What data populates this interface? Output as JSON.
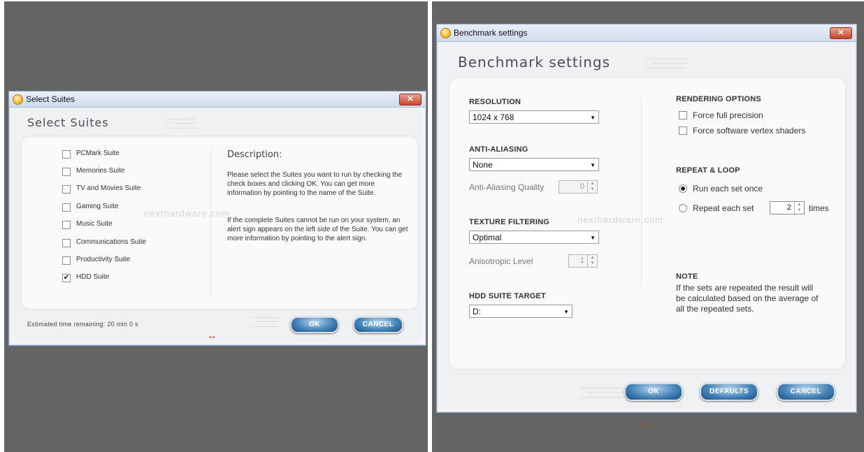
{
  "left_window": {
    "title": "Select Suites",
    "header": "Select Suites",
    "close_label": "✕",
    "suites": [
      {
        "label": "PCMark Suite",
        "checked": false
      },
      {
        "label": "Memories Suite",
        "checked": false
      },
      {
        "label": "TV and Movies Suite",
        "checked": false
      },
      {
        "label": "Gaming Suite",
        "checked": false
      },
      {
        "label": "Music Suite",
        "checked": false
      },
      {
        "label": "Communications Suite",
        "checked": false
      },
      {
        "label": "Productivity Suite",
        "checked": false
      },
      {
        "label": "HDD Suite",
        "checked": true
      }
    ],
    "description_heading": "Description:",
    "description_p1": "Please select the Suites you want to run by checking the check boxes and clicking OK. You can get more information by pointing to the name of the Suite.",
    "description_p2": "If the complete Suites cannot be run on your system, an alert sign appears on the left side of the Suite. You can get more information by pointing to the alert sign.",
    "estimated_time": "Estimated time remaining: 20 min 0 s",
    "ok_label": "OK",
    "cancel_label": "CANCEL"
  },
  "right_window": {
    "title": "Benchmark settings",
    "header": "Benchmark settings",
    "close_label": "✕",
    "resolution": {
      "heading": "RESOLUTION",
      "value": "1024 x 768"
    },
    "anti_aliasing": {
      "heading": "ANTI-ALIASING",
      "value": "None",
      "quality_label": "Anti-Aliasing Quality",
      "quality_value": "0"
    },
    "texture_filtering": {
      "heading": "TEXTURE FILTERING",
      "value": "Optimal",
      "aniso_label": "Anisotropic Level",
      "aniso_value": "1"
    },
    "hdd_target": {
      "heading": "HDD SUITE TARGET",
      "value": "D:"
    },
    "rendering_options": {
      "heading": "RENDERING OPTIONS",
      "force_full_precision": "Force full precision",
      "force_software_vertex": "Force software vertex shaders"
    },
    "repeat_loop": {
      "heading": "REPEAT & LOOP",
      "run_once": "Run each set once",
      "repeat_each": "Repeat each set",
      "repeat_count": "2",
      "times": "times",
      "selected": "run_once"
    },
    "note": {
      "heading": "NOTE",
      "text": "If the sets are repeated the result will be calculated based on the average of all the repeated sets."
    },
    "ok_label": "OK",
    "defaults_label": "DEFAULTS",
    "cancel_label": "CANCEL"
  },
  "watermark": "nexthardware.com",
  "resize_glyph": "↔",
  "colors": {
    "background": "#646464",
    "button_blue": "#3f7fb6",
    "close_red": "#c9452c"
  }
}
